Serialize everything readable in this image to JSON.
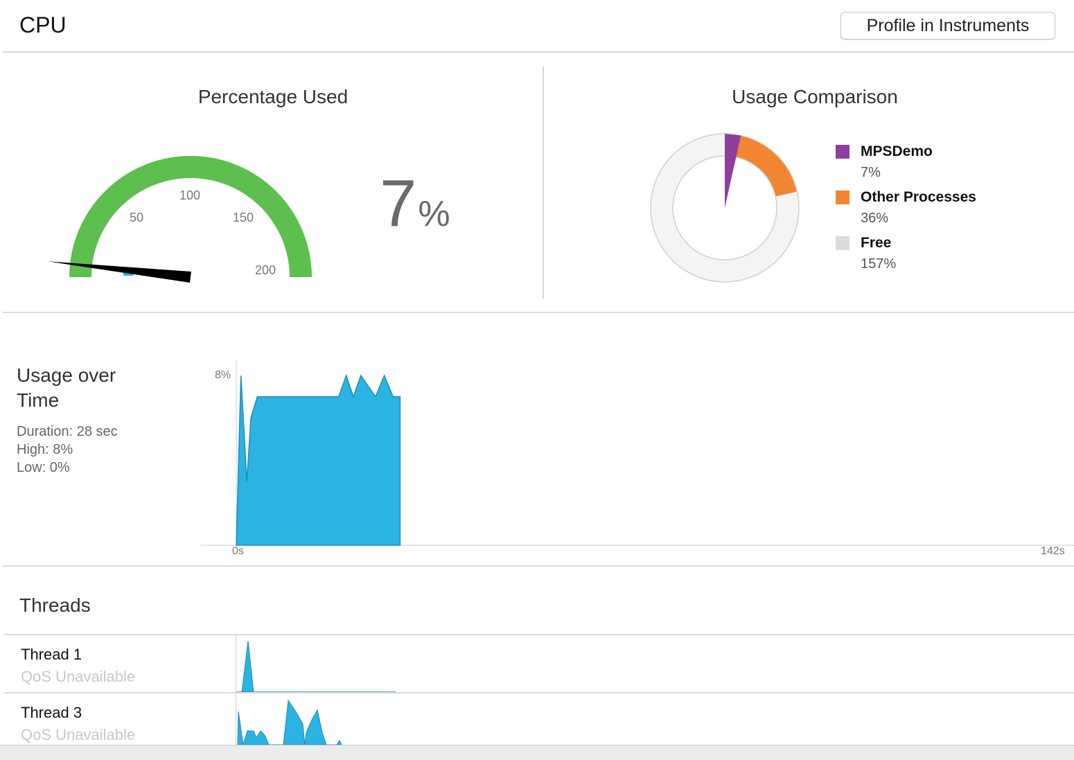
{
  "header": {
    "title": "CPU",
    "profile_button": "Profile in Instruments"
  },
  "percentage_used": {
    "title": "Percentage Used",
    "gauge_ticks": [
      "50",
      "100",
      "150",
      "200"
    ],
    "gauge_max": 200,
    "needle_value": 7,
    "value": "7",
    "unit": "%",
    "colors": {
      "arc": "#5cbf4e",
      "needle": "#000000"
    }
  },
  "usage_comparison": {
    "title": "Usage Comparison",
    "items": [
      {
        "label": "MPSDemo",
        "value": "7%",
        "percent": 7,
        "color": "#8e3f9d"
      },
      {
        "label": "Other Processes",
        "value": "36%",
        "percent": 36,
        "color": "#f28630"
      },
      {
        "label": "Free",
        "value": "157%",
        "percent": 157,
        "color": "#dcdcdc"
      }
    ],
    "total_percent": 200
  },
  "usage_over_time": {
    "title": "Usage over Time",
    "duration": "Duration: 28 sec",
    "high": "High: 8%",
    "low": "Low: 0%",
    "y_label": "8%",
    "x_start": "0s",
    "x_end": "142s"
  },
  "chart_data": {
    "type": "area",
    "title": "Usage over Time",
    "xlabel": "",
    "ylabel": "",
    "xlim": [
      0,
      142
    ],
    "ylim": [
      0,
      8
    ],
    "tick_labels": {
      "y": [
        "8%"
      ],
      "x": [
        "0s",
        "142s"
      ]
    },
    "series": [
      {
        "color": "#2bb3e3",
        "x": [
          0,
          0.8,
          1.8,
          2.5,
          3.6,
          5,
          17.5,
          18.8,
          20,
          21.3,
          23.8,
          25.3,
          26.8,
          28
        ],
        "y": [
          0,
          8,
          3,
          6,
          7,
          7,
          7,
          8,
          7,
          8,
          7,
          8,
          7,
          7
        ]
      }
    ]
  },
  "threads": {
    "title": "Threads",
    "items": [
      {
        "name": "Thread 1",
        "qos": "QoS Unavailable"
      },
      {
        "name": "Thread 3",
        "qos": "QoS Unavailable"
      }
    ]
  }
}
